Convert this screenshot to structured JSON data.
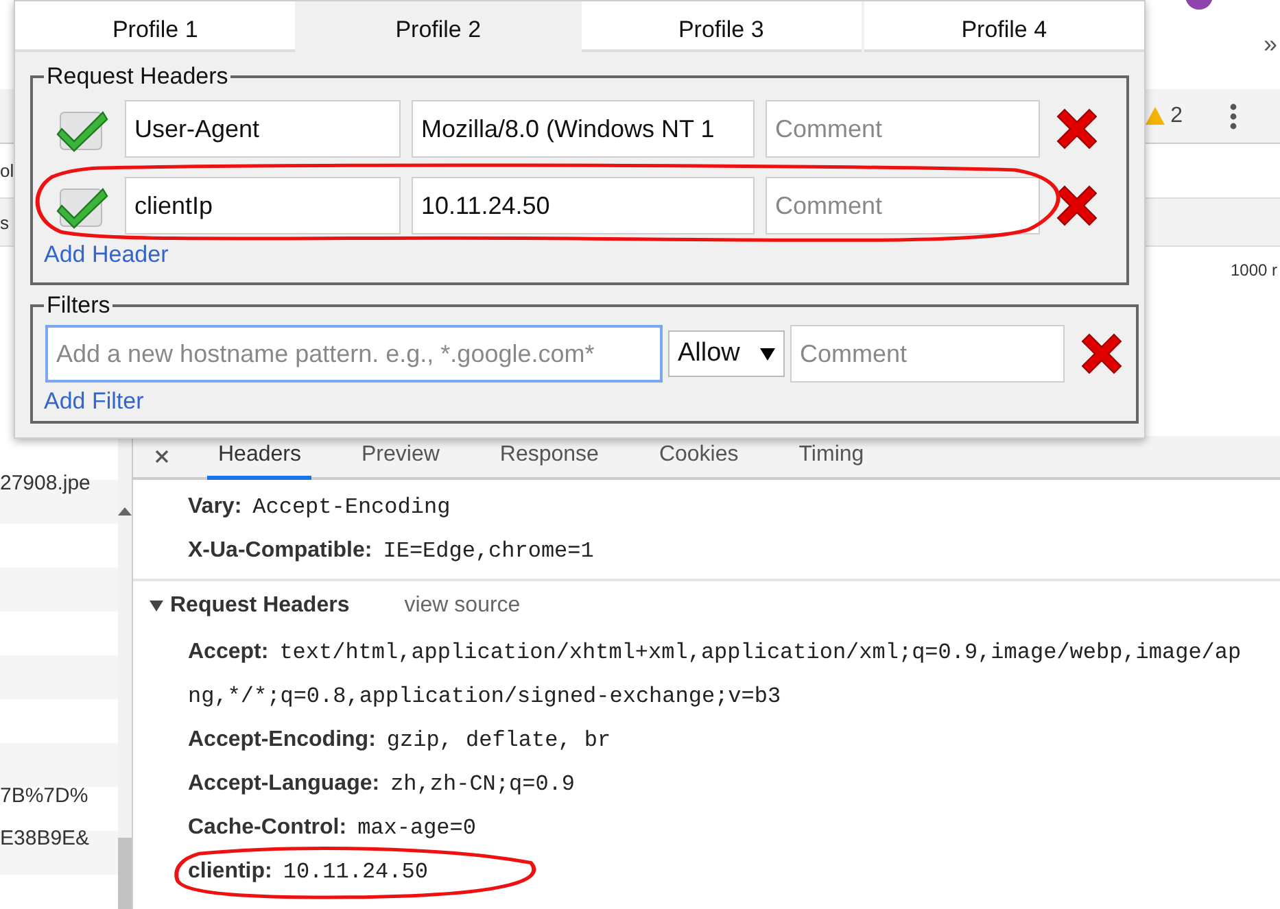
{
  "browser": {
    "overflow": "»"
  },
  "devtools": {
    "warning_count": "2",
    "side_fragments": [
      "ol",
      "s"
    ],
    "timeline_label": "1000 r",
    "request_list": [
      {
        "name": "27908.jpe"
      },
      {
        "name": "7B%7D%"
      },
      {
        "name": "E38B9E&"
      }
    ],
    "detail_tabs": [
      {
        "label": "Headers",
        "selected": true
      },
      {
        "label": "Preview",
        "selected": false
      },
      {
        "label": "Response",
        "selected": false
      },
      {
        "label": "Cookies",
        "selected": false
      },
      {
        "label": "Timing",
        "selected": false
      }
    ],
    "response_headers": [
      {
        "name": "Vary:",
        "value": "Accept-Encoding",
        "circled": false
      },
      {
        "name": "X-Ua-Compatible:",
        "value": "IE=Edge,chrome=1",
        "circled": false
      }
    ],
    "request_headers": {
      "title": "Request Headers",
      "expanded": true,
      "view_source": "view source",
      "headers": [
        {
          "name": "Accept:",
          "value": "text/html,application/xhtml+xml,application/xml;q=0.9,image/webp,image/ap",
          "continuation": "ng,*/*;q=0.8,application/signed-exchange;v=b3",
          "circled": false
        },
        {
          "name": "Accept-Encoding:",
          "value": "gzip, deflate, br",
          "circled": false
        },
        {
          "name": "Accept-Language:",
          "value": "zh,zh-CN;q=0.9",
          "circled": false
        },
        {
          "name": "Cache-Control:",
          "value": "max-age=0",
          "circled": false
        },
        {
          "name": "clientip:",
          "value": "10.11.24.50",
          "circled": true
        }
      ]
    }
  },
  "popup": {
    "tabs": [
      {
        "label": "Profile 1",
        "selected": false
      },
      {
        "label": "Profile 2",
        "selected": true
      },
      {
        "label": "Profile 3",
        "selected": false
      },
      {
        "label": "Profile 4",
        "selected": false
      }
    ],
    "request_headers": {
      "legend": "Request Headers",
      "add_link": "Add Header",
      "rows": [
        {
          "enabled": true,
          "name": "User-Agent",
          "value": "Mozilla/8.0 (Windows NT 1",
          "comment_placeholder": "Comment",
          "circled": false
        },
        {
          "enabled": true,
          "name": "clientIp",
          "value": "10.11.24.50",
          "comment_placeholder": "Comment",
          "circled": true
        }
      ]
    },
    "filters": {
      "legend": "Filters",
      "add_link": "Add Filter",
      "rows": [
        {
          "placeholder": "Add a new hostname pattern. e.g., *.google.com*",
          "focused": true,
          "mode": "Allow",
          "comment_placeholder": "Comment"
        }
      ]
    }
  }
}
